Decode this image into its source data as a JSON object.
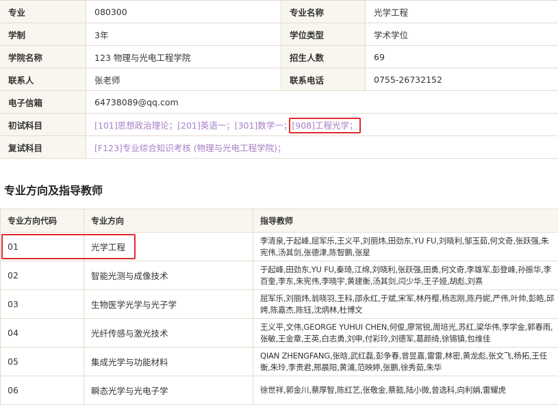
{
  "info": {
    "major_code_label": "专业",
    "major_code": "080300",
    "major_name_label": "专业名称",
    "major_name": "光学工程",
    "duration_label": "学制",
    "duration": "3年",
    "degree_type_label": "学位类型",
    "degree_type": "学术学位",
    "college_label": "学院名称",
    "college": "123 物理与光电工程学院",
    "enrollment_label": "招生人数",
    "enrollment": "69",
    "contact_label": "联系人",
    "contact": "张老师",
    "phone_label": "联系电话",
    "phone": "0755-26732152",
    "email_label": "电子信箱",
    "email": "64738089@qq.com",
    "exam_label": "初试科目",
    "exam_subjects": [
      "[101]思想政治理论；",
      "[201]英语一；",
      "[301]数学一；",
      "[908]工程光学；"
    ],
    "retest_label": "复试科目",
    "retest_subject": "[F123]专业综合知识考核 (物理与光电工程学院)；"
  },
  "section_title": "专业方向及指导教师",
  "directions": {
    "headers": [
      "专业方向代码",
      "专业方向",
      "指导教师"
    ],
    "rows": [
      {
        "code": "01",
        "name": "光学工程",
        "teachers": "李清泉,于起峰,屈军乐,王义平,刘丽炜,田劲东,YU FU,刘晓利,邹玉茹,何文奇,张跃强,朱宪伟,汤其剑,张德津,陈智鹏,张星"
      },
      {
        "code": "02",
        "name": "智能光测与成像技术",
        "teachers": "于起峰,田劲东,YU FU,秦琦,江绵,刘晓利,张跃强,田勇,何文奇,李雄军,彭登峰,孙振华,李百奎,李东,朱宪伟,李晓宇,黄建衡,汤其剑,闫少华,王子娅,胡彪,刘熹"
      },
      {
        "code": "03",
        "name": "生物医学光学与光子学",
        "teachers": "屈军乐,刘丽炜,翁晓羽,王科,邵永红,于斌,宋军,林丹樱,杨志刚,陈丹妮,严伟,叶帅,彭皓,邱娉,陈嘉杰,陈钰,沈炳林,杜博文"
      },
      {
        "code": "04",
        "name": "光纤传感与激光技术",
        "teachers": "王义平,文伟,GEORGE YUHUI CHEN,何俊,廖常锐,周培光,苏红,梁华伟,李学金,郭春雨,张敏,王金章,王英,白志勇,刘申,付彩玲,刘德军,葛颜绮,徐锡镇,包维佳"
      },
      {
        "code": "05",
        "name": "集成光学与功能材料",
        "teachers": "QIAN ZHENGFANG,张晗,武红磊,彭争春,曾昱嘉,雷雷,林密,黄龙彪,张文飞,杨拓,王任衡,朱玲,李贵君,邢晨阳,黄浦,范映婷,张鹏,徐秀茹,朱华"
      },
      {
        "code": "06",
        "name": "瞬态光学与光电子学",
        "teachers": "徐世祥,郭金川,蔡厚智,陈红艺,张敬金,蔡懿,陆小微,曾选科,向利娟,雷耀虎"
      }
    ]
  }
}
